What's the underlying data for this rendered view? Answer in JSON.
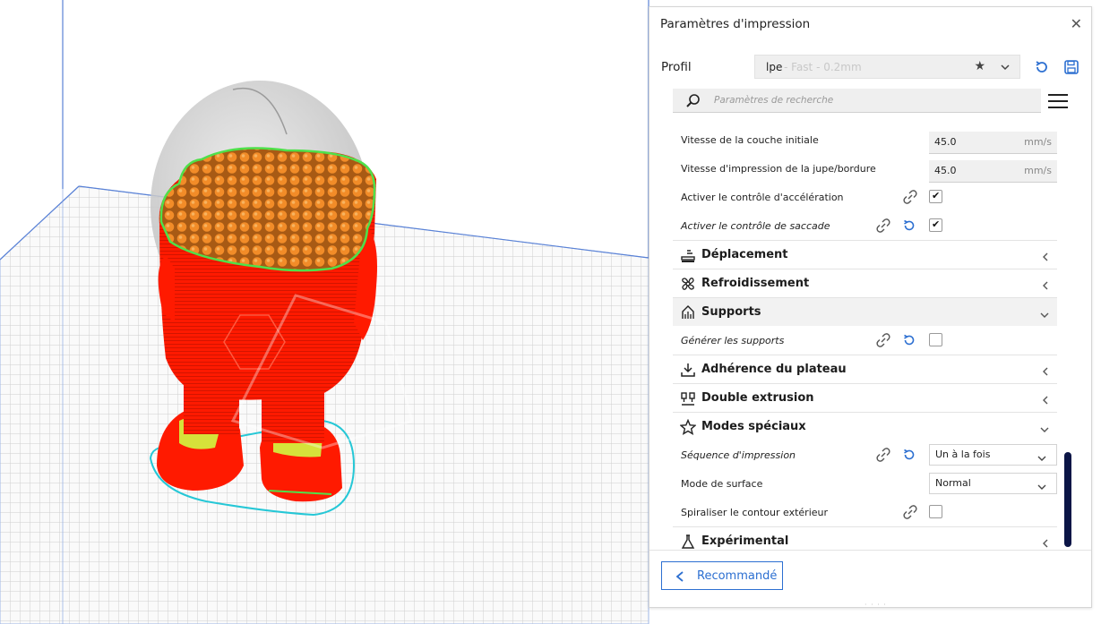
{
  "colors": {
    "accent": "#2c6fd1",
    "model_body": "#ff1a00",
    "infill": "#f28c28",
    "support_highlight": "#4fe04a",
    "scrollbar": "#0b1546"
  },
  "panel": {
    "title": "Paramètres d'impression",
    "close_icon": "close-icon",
    "profile": {
      "label": "Profil",
      "name": "lpe",
      "subtitle": " - Fast - 0.2mm"
    },
    "search": {
      "placeholder": "Paramètres de recherche"
    },
    "rows": [
      {
        "type": "field",
        "label": "Vitesse de la couche initiale",
        "value": "45.0",
        "unit": "mm/s"
      },
      {
        "type": "field",
        "label": "Vitesse d'impression de la jupe/bordure",
        "value": "45.0",
        "unit": "mm/s"
      },
      {
        "type": "checkbox",
        "label": "Activer le contrôle d'accélération",
        "checked": true,
        "link": true,
        "reset": false,
        "italic": false
      },
      {
        "type": "checkbox",
        "label": "Activer le contrôle de saccade",
        "checked": true,
        "link": true,
        "reset": true,
        "italic": true
      },
      {
        "type": "category",
        "label": "Déplacement",
        "icon": "travel-icon",
        "open": false
      },
      {
        "type": "category",
        "label": "Refroidissement",
        "icon": "fan-icon",
        "open": false
      },
      {
        "type": "category",
        "label": "Supports",
        "icon": "support-icon",
        "open": true
      },
      {
        "type": "checkbox",
        "label": "Générer les supports",
        "checked": false,
        "link": true,
        "reset": true,
        "italic": true
      },
      {
        "type": "category",
        "label": "Adhérence du plateau",
        "icon": "adhesion-icon",
        "open": false
      },
      {
        "type": "category",
        "label": "Double extrusion",
        "icon": "dual-extrusion-icon",
        "open": false
      },
      {
        "type": "category",
        "label": "Modes spéciaux",
        "icon": "star-icon",
        "open": true
      },
      {
        "type": "select",
        "label": "Séquence d'impression",
        "value": "Un à la fois",
        "link": true,
        "reset": true,
        "italic": true
      },
      {
        "type": "select",
        "label": "Mode de surface",
        "value": "Normal",
        "link": false,
        "reset": false,
        "italic": false
      },
      {
        "type": "checkbox",
        "label": "Spiraliser le contour extérieur",
        "checked": false,
        "link": true,
        "reset": false,
        "italic": false
      },
      {
        "type": "category",
        "label": "Expérimental",
        "icon": "flask-icon",
        "open": false
      }
    ],
    "recommended_button": "Recommandé"
  }
}
